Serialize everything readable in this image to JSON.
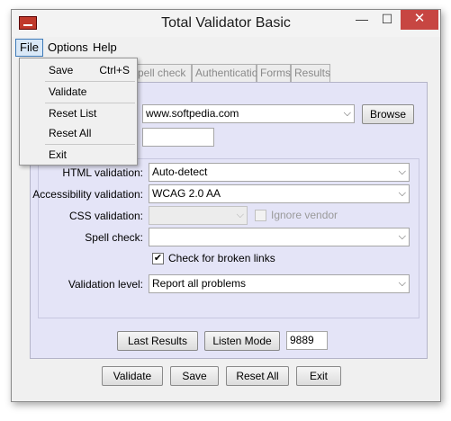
{
  "window": {
    "title": "Total Validator Basic",
    "minimize_glyph": "—",
    "maximize_glyph": "☐",
    "close_glyph": "✕"
  },
  "menubar": {
    "file": "File",
    "options": "Options",
    "help": "Help"
  },
  "file_menu": {
    "save": "Save",
    "save_accel": "Ctrl+S",
    "validate": "Validate",
    "reset_list": "Reset List",
    "reset_all": "Reset All",
    "exit": "Exit"
  },
  "tabs": {
    "spell_check": "pell check",
    "authentication": "Authentication",
    "forms": "Forms",
    "results": "Results"
  },
  "url_combo": {
    "value": "www.softpedia.com"
  },
  "browse_button": "Browse",
  "options": {
    "html_label": "HTML validation:",
    "html_value": "Auto-detect",
    "accessibility_label": "Accessibility validation:",
    "accessibility_value": "WCAG 2.0 AA",
    "css_label": "CSS validation:",
    "css_value": "",
    "ignore_vendor": "Ignore vendor",
    "spell_label": "Spell check:",
    "spell_value": "",
    "broken_links": "Check for broken links",
    "level_label": "Validation level:",
    "level_value": "Report all problems"
  },
  "last_results_button": "Last Results",
  "listen_mode_button": "Listen Mode",
  "port_value": "9889",
  "bottom": {
    "validate": "Validate",
    "save": "Save",
    "reset_all": "Reset All",
    "exit": "Exit"
  }
}
